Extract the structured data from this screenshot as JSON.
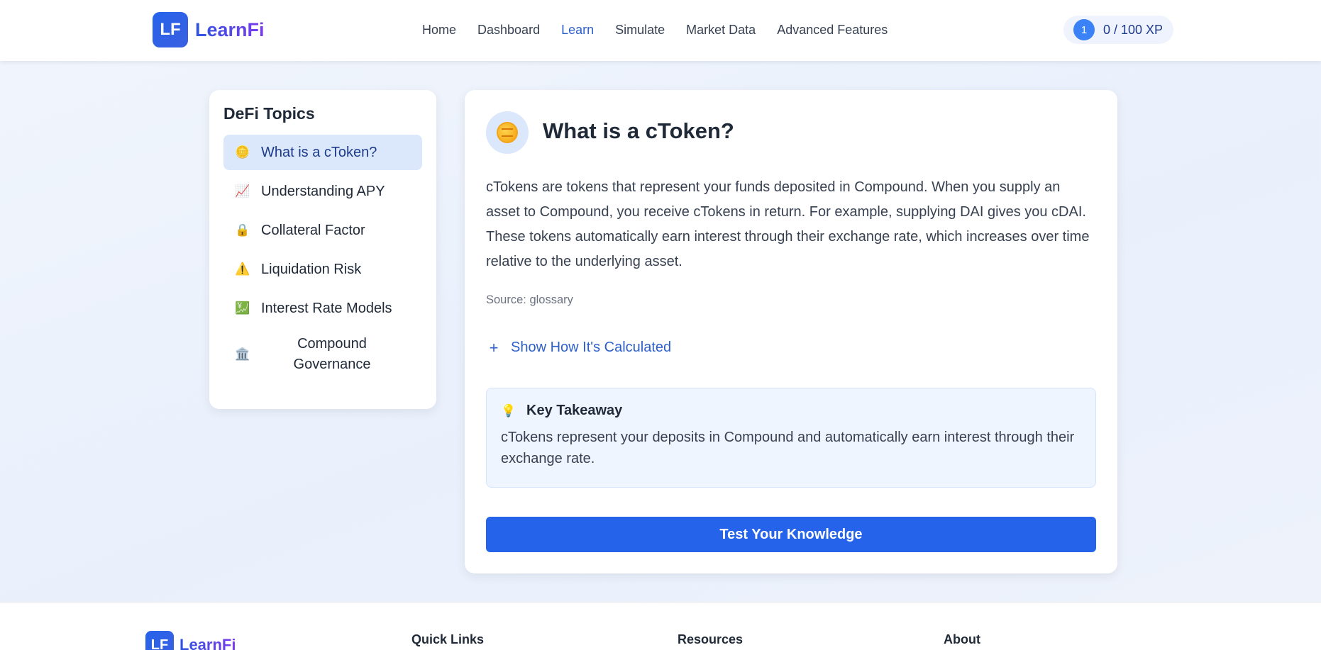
{
  "header": {
    "logo_initials": "LF",
    "logo_text": "LearnFi",
    "nav": [
      "Home",
      "Dashboard",
      "Learn",
      "Simulate",
      "Market Data",
      "Advanced Features"
    ],
    "active_nav": "Learn",
    "xp_level": "1",
    "xp_text": "0 / 100 XP"
  },
  "sidebar": {
    "title": "DeFi Topics",
    "items": [
      {
        "label": "What is a cToken?",
        "icon": "coin-icon",
        "glyph": "🪙",
        "active": true
      },
      {
        "label": "Understanding APY",
        "icon": "chart-up-icon",
        "glyph": "📈",
        "active": false
      },
      {
        "label": "Collateral Factor",
        "icon": "lock-icon",
        "glyph": "🔒",
        "active": false
      },
      {
        "label": "Liquidation Risk",
        "icon": "warning-icon",
        "glyph": "⚠️",
        "active": false
      },
      {
        "label": "Interest Rate Models",
        "icon": "chart-green-icon",
        "glyph": "💹",
        "active": false
      },
      {
        "label": "Compound Governance",
        "icon": "bank-icon",
        "glyph": "🏛️",
        "active": false
      }
    ]
  },
  "main": {
    "title": "What is a cToken?",
    "body": "cTokens are tokens that represent your funds deposited in Compound. When you supply an asset to Compound, you receive cTokens in return. For example, supplying DAI gives you cDAI. These tokens automatically earn interest through their exchange rate, which increases over time relative to the underlying asset.",
    "source": "Source: glossary",
    "show_calc_label": "Show How It's Calculated",
    "takeaway_title": "Key Takeaway",
    "takeaway_text": "cTokens represent your deposits in Compound and automatically earn interest through their exchange rate.",
    "test_button": "Test Your Knowledge"
  },
  "footer": {
    "logo_initials": "LF",
    "logo_text": "LearnFi",
    "headings": [
      "Quick Links",
      "Resources",
      "About"
    ]
  },
  "colors": {
    "accent": "#2563eb",
    "active_nav": "#2c5fc9",
    "active_topic_bg": "#dbe8fc",
    "takeaway_bg": "#eff5fe"
  }
}
